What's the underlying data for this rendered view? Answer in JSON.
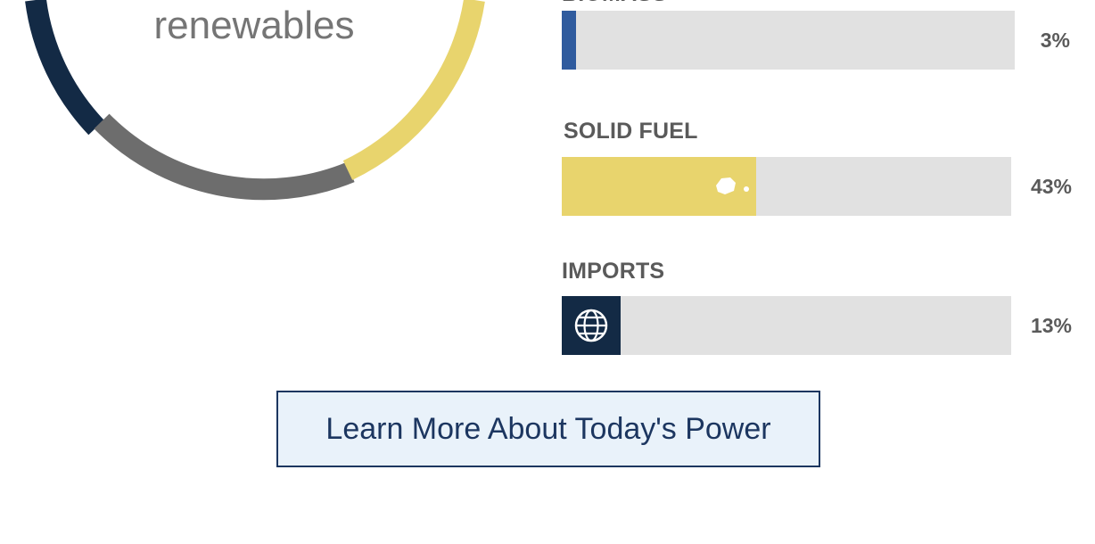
{
  "donut": {
    "center_text": "renewables",
    "colors": {
      "dark_navy": "#132a45",
      "gray": "#6d6d6d",
      "yellow": "#e8d46d"
    }
  },
  "sources": [
    {
      "label": "BIOMASS",
      "label_visible": "partially cut off at top",
      "percent_text": "3%",
      "value": 3,
      "color": "#2f5b9e",
      "icon": "none"
    },
    {
      "label": "SOLID FUEL",
      "percent_text": "43%",
      "value": 43,
      "color": "#e8d46d",
      "icon": "coal-icon"
    },
    {
      "label": "IMPORTS",
      "percent_text": "13%",
      "value": 13,
      "color": "#132a45",
      "icon": "globe-icon"
    }
  ],
  "cta": {
    "label": "Learn More About Today's Power"
  }
}
